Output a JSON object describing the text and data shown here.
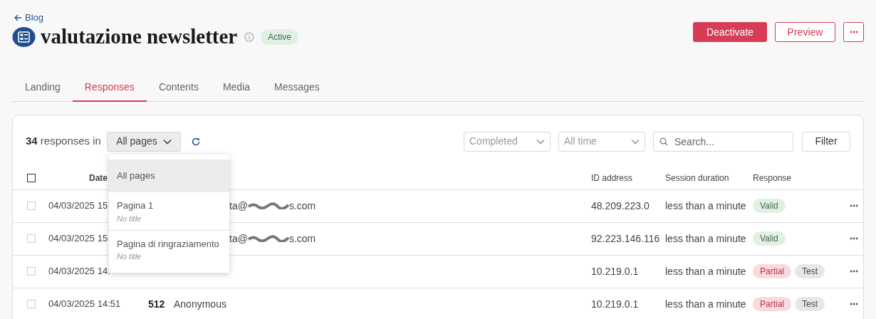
{
  "back_link": "Blog",
  "title": "valutazione newsletter",
  "status_badge": "Active",
  "actions": {
    "primary": "Deactivate",
    "secondary": "Preview"
  },
  "tabs": [
    {
      "label": "Landing",
      "selected": false
    },
    {
      "label": "Responses",
      "selected": true
    },
    {
      "label": "Contents",
      "selected": false
    },
    {
      "label": "Media",
      "selected": false
    },
    {
      "label": "Messages",
      "selected": false
    }
  ],
  "toolbar": {
    "count": "34",
    "count_suffix": "responses in",
    "page_select": "All pages",
    "status_select": {
      "placeholder": "Completed"
    },
    "time_select": {
      "placeholder": "All time"
    },
    "search": {
      "placeholder": "Search..."
    },
    "filter_button": "Filter"
  },
  "page_menu": [
    {
      "label": "All pages",
      "selected": true
    },
    {
      "label": "Pagina 1",
      "subtitle": "No title",
      "selected": false
    },
    {
      "label": "Pagina di ringraziamento",
      "subtitle": "No title",
      "selected": false
    }
  ],
  "table": {
    "select_all_checked": false,
    "columns": [
      "Date",
      "ID address",
      "Session duration",
      "Response"
    ],
    "rows": [
      {
        "checked": false,
        "date": "04/03/2025 15",
        "email_start": "ta@",
        "email_end": "s.com",
        "ip": "48.209.223.0",
        "duration": "less than a minute",
        "tags": [
          {
            "label": "Valid",
            "kind": "valid"
          }
        ]
      },
      {
        "checked": false,
        "date": "04/03/2025 15",
        "email_start": "ta@",
        "email_end": "s.com",
        "ip": "92.223.146.116",
        "duration": "less than a minute",
        "tags": [
          {
            "label": "Valid",
            "kind": "valid"
          }
        ]
      },
      {
        "checked": false,
        "date": "04/03/2025 14:",
        "ip": "10.219.0.1",
        "duration": "less than a minute",
        "tags": [
          {
            "label": "Partial",
            "kind": "partial"
          },
          {
            "label": "Test",
            "kind": "test"
          }
        ]
      },
      {
        "checked": false,
        "date": "04/03/2025 14:51",
        "id": "512",
        "name": "Anonymous",
        "ip": "10.219.0.1",
        "duration": "less than a minute",
        "tags": [
          {
            "label": "Partial",
            "kind": "partial"
          },
          {
            "label": "Test",
            "kind": "test"
          }
        ]
      }
    ]
  }
}
